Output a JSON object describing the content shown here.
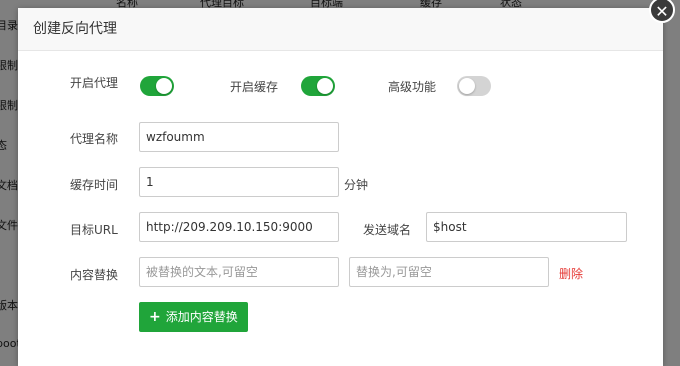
{
  "background": {
    "sidebar_items": [
      "目录",
      "限制",
      "限制",
      "态",
      "文档",
      "文件",
      "版本",
      "boot"
    ],
    "top_row": [
      "名称",
      "代理目标",
      "目标端",
      "缓存",
      "状态"
    ]
  },
  "dialog": {
    "title": "创建反向代理",
    "close_icon": "✕",
    "toggles": {
      "proxy": {
        "label": "开启代理",
        "on": true
      },
      "cache": {
        "label": "开启缓存",
        "on": true
      },
      "advanced": {
        "label": "高级功能",
        "on": false
      }
    },
    "proxy_name": {
      "label": "代理名称",
      "value": "wzfoumm"
    },
    "cache_time": {
      "label": "缓存时间",
      "value": "1",
      "unit": "分钟"
    },
    "target_url": {
      "label": "目标URL",
      "value": "http://209.209.10.150:9000"
    },
    "send_domain": {
      "label": "发送域名",
      "value": "$host"
    },
    "content_replace": {
      "label": "内容替换",
      "from_placeholder": "被替换的文本,可留空",
      "to_placeholder": "替换为,可留空",
      "delete_label": "删除"
    },
    "add_replace_button": {
      "icon": "+",
      "label": "添加内容替换"
    }
  }
}
